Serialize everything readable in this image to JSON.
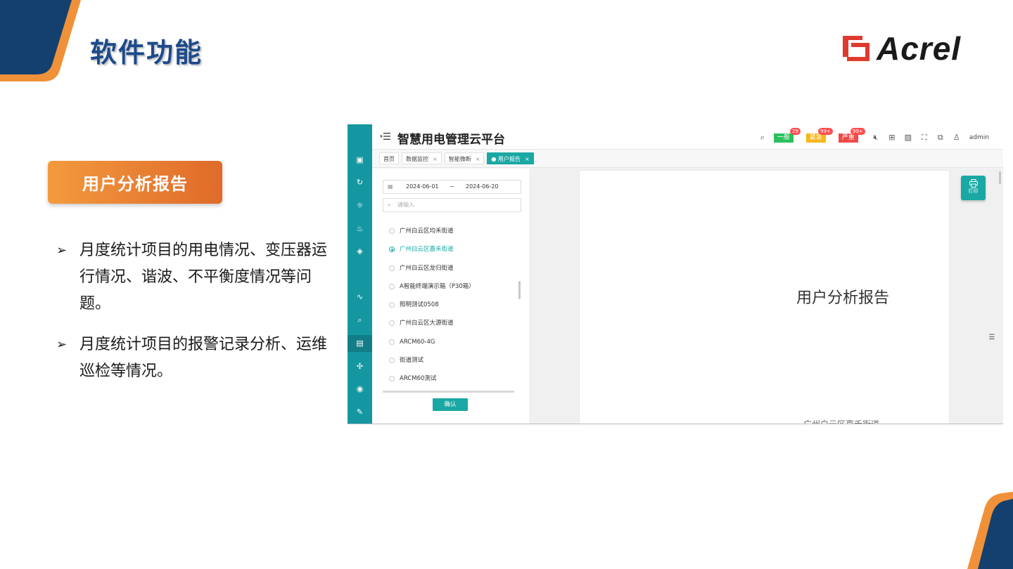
{
  "slide": {
    "title": "软件功能",
    "logo_text": "Acrel",
    "section_badge": "用户分析报告",
    "bullets": [
      "月度统计项目的用电情况、变压器运行情况、谐波、不平衡度情况等问题。",
      "月度统计项目的报警记录分析、运维巡检等情况。"
    ],
    "colors": {
      "title": "#1c4a8c",
      "badge_start": "#f29a3e",
      "badge_end": "#e06a2a",
      "corner_navy": "#13406f",
      "corner_orange": "#f0913a",
      "app_teal": "#1597a1"
    }
  },
  "app": {
    "title": "智慧用电管理云平台",
    "header": {
      "alerts": [
        {
          "label": "一般",
          "count": "29",
          "color": "#2bbf5b"
        },
        {
          "label": "紧急",
          "count": "99+",
          "color": "#f5b71a"
        },
        {
          "label": "严重",
          "count": "99+",
          "color": "#ef4a4a"
        }
      ],
      "user": "admin"
    },
    "tabs": [
      {
        "label": "首页",
        "closable": false,
        "active": false
      },
      {
        "label": "数据监控",
        "closable": true,
        "active": false
      },
      {
        "label": "智能微断",
        "closable": true,
        "active": false
      },
      {
        "label": "● 用户报告",
        "closable": true,
        "active": true
      }
    ],
    "filters": {
      "start_date": "2024-06-01",
      "separator": "~",
      "end_date": "2024-06-20",
      "search_placeholder": "请输入"
    },
    "projects": [
      {
        "name": "广州白云区均禾街道",
        "selected": false
      },
      {
        "name": "广州白云区嘉禾街道",
        "selected": true
      },
      {
        "name": "广州白云区龙归街道",
        "selected": false
      },
      {
        "name": "A智能终端演示箱（P30箱）",
        "selected": false
      },
      {
        "name": "照明测试0508",
        "selected": false
      },
      {
        "name": "广州白云区大源街道",
        "selected": false
      },
      {
        "name": "ARCM60-4G",
        "selected": false
      },
      {
        "name": "街道测试",
        "selected": false
      },
      {
        "name": "ARCM60测试",
        "selected": false
      }
    ],
    "confirm_label": "确认",
    "report": {
      "title": "用户分析报告",
      "subtitle": "广州白云区嘉禾街道"
    },
    "print_label": "打印"
  }
}
